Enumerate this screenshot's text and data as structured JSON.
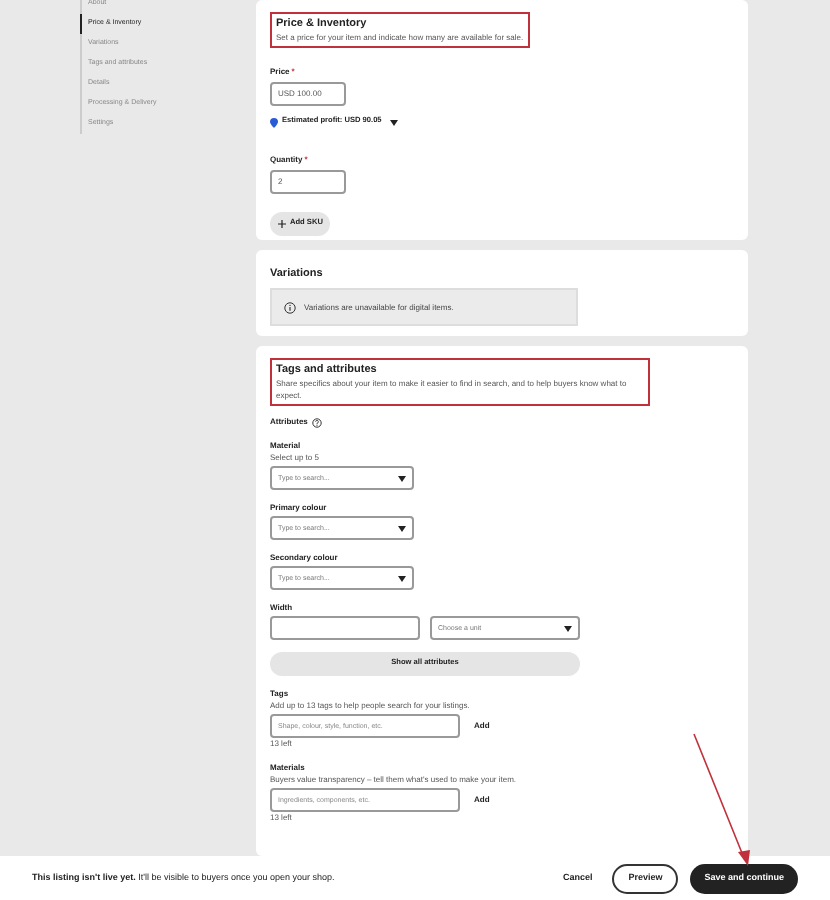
{
  "sidebar": {
    "items": [
      {
        "label": "About",
        "selected": false
      },
      {
        "label": "Price & Inventory",
        "selected": true
      },
      {
        "label": "Variations",
        "selected": false
      },
      {
        "label": "Tags and attributes",
        "selected": false
      },
      {
        "label": "Details",
        "selected": false
      },
      {
        "label": "Processing & Delivery",
        "selected": false
      },
      {
        "label": "Settings",
        "selected": false
      }
    ]
  },
  "price_inventory": {
    "title": "Price & Inventory",
    "description": "Set a price for your item and indicate how many are available for sale.",
    "price": {
      "label": "Price",
      "required_mark": "*",
      "value": "USD 100.00"
    },
    "estimated_profit": "Estimated profit: USD 90.05",
    "quantity": {
      "label": "Quantity",
      "required_mark": "*",
      "value": "2"
    },
    "add_sku": "Add SKU"
  },
  "variations": {
    "title": "Variations",
    "notice": "Variations are unavailable for digital items."
  },
  "tags_attributes": {
    "title": "Tags and attributes",
    "description": "Share specifics about your item to make it easier to find in search, and to help buyers know what to expect.",
    "attributes_label": "Attributes",
    "attributes": [
      {
        "kind": "select",
        "label": "Material",
        "hint": "Select up to 5",
        "placeholder": "Type to search..."
      },
      {
        "kind": "select",
        "label": "Primary colour",
        "placeholder": "Type to search..."
      },
      {
        "kind": "select",
        "label": "Secondary colour",
        "placeholder": "Type to search..."
      },
      {
        "kind": "dimension",
        "label": "Width",
        "unit_placeholder": "Choose a unit"
      }
    ],
    "show_all": "Show all attributes",
    "inputs": [
      {
        "label": "Tags",
        "description": "Add up to 13 tags to help people search for your listings.",
        "placeholder": "Shape, colour, style, function, etc.",
        "button": "Add",
        "counter": "13 left"
      },
      {
        "label": "Materials",
        "description": "Buyers value transparency – tell them what's used to make your item.",
        "placeholder": "Ingredients, components, etc.",
        "button": "Add",
        "counter": "13 left"
      }
    ]
  },
  "footer": {
    "message_bold": "This listing isn't live yet.",
    "message": "It'll be visible to buyers once you open your shop.",
    "cancel": "Cancel",
    "preview": "Preview",
    "save": "Save and continue"
  }
}
